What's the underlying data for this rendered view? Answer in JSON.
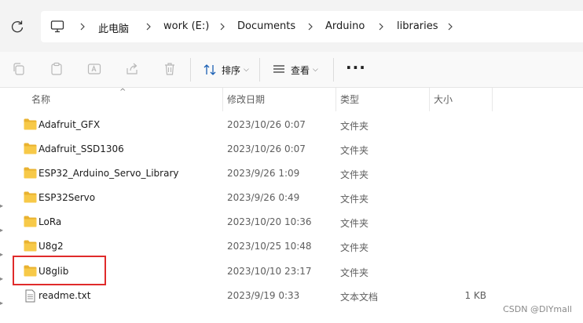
{
  "breadcrumb": [
    "此电脑",
    "work (E:)",
    "Documents",
    "Arduino",
    "libraries"
  ],
  "toolbar": {
    "sort_label": "排序",
    "view_label": "查看",
    "more_label": "···"
  },
  "columns": {
    "name": "名称",
    "modified": "修改日期",
    "type": "类型",
    "size": "大小"
  },
  "files": [
    {
      "name": "Adafruit_GFX",
      "modified": "2023/10/26 0:07",
      "type": "文件夹",
      "size": "",
      "icon": "folder-icon"
    },
    {
      "name": "Adafruit_SSD1306",
      "modified": "2023/10/26 0:07",
      "type": "文件夹",
      "size": "",
      "icon": "folder-icon"
    },
    {
      "name": "ESP32_Arduino_Servo_Library",
      "modified": "2023/9/26 1:09",
      "type": "文件夹",
      "size": "",
      "icon": "folder-icon"
    },
    {
      "name": "ESP32Servo",
      "modified": "2023/9/26 0:49",
      "type": "文件夹",
      "size": "",
      "icon": "folder-icon"
    },
    {
      "name": "LoRa",
      "modified": "2023/10/20 10:36",
      "type": "文件夹",
      "size": "",
      "icon": "folder-icon"
    },
    {
      "name": "U8g2",
      "modified": "2023/10/25 10:48",
      "type": "文件夹",
      "size": "",
      "icon": "folder-icon"
    },
    {
      "name": "U8glib",
      "modified": "2023/10/10 23:17",
      "type": "文件夹",
      "size": "",
      "icon": "folder-icon"
    },
    {
      "name": "readme.txt",
      "modified": "2023/9/19 0:33",
      "type": "文本文档",
      "size": "1 KB",
      "icon": "text-file-icon"
    }
  ],
  "watermark": "CSDN @DIYmall",
  "colors": {
    "folder": "#f7c948",
    "highlight": "#e02b2b",
    "accent": "#0067c0"
  }
}
